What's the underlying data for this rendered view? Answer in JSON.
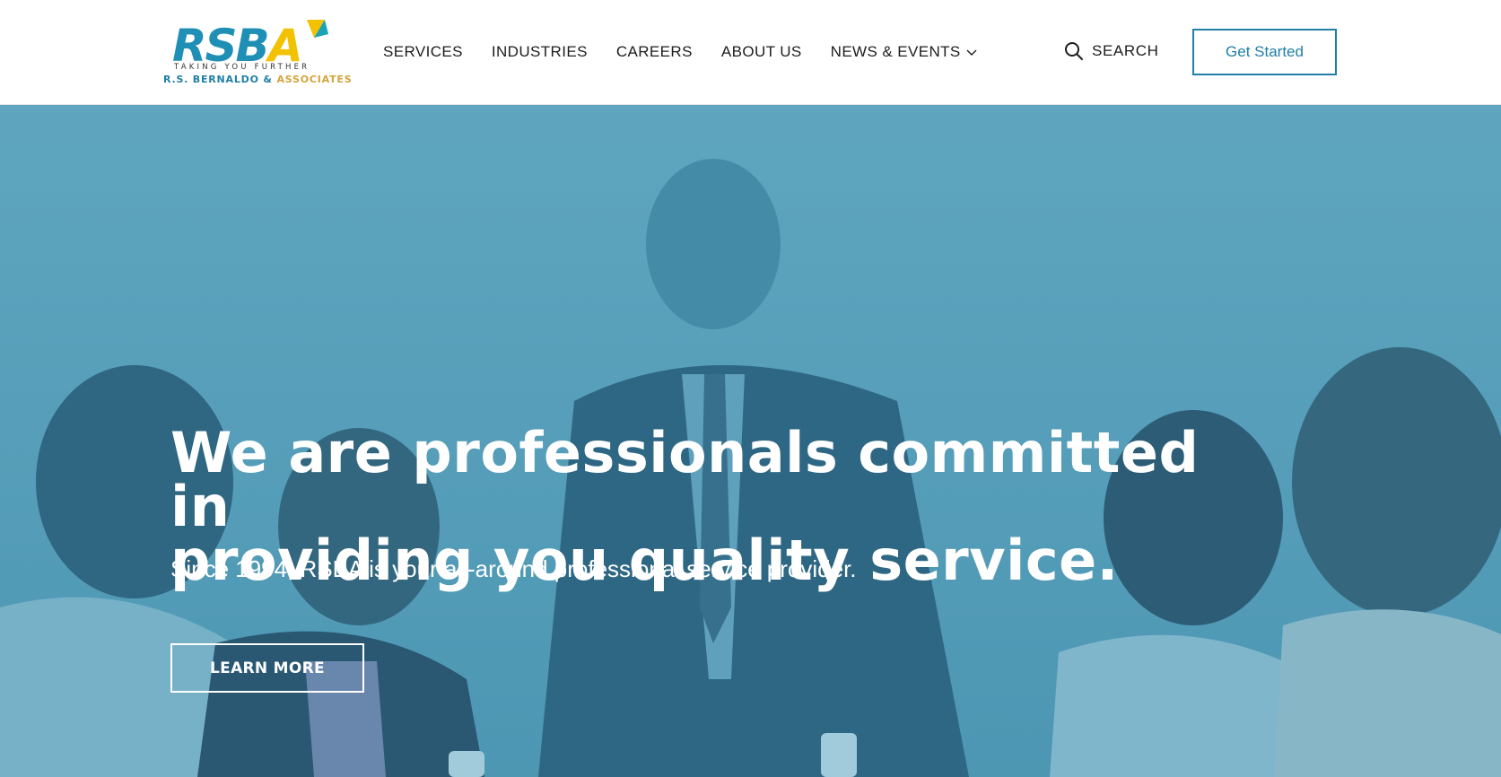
{
  "brand": {
    "logo_text": "RSBA",
    "tagline": "TAKING YOU FURTHER",
    "company_part1": "R.S. BERNALDO &",
    "company_part2": "ASSOCIATES",
    "colors": {
      "blue": "#1f7fa6",
      "gold": "#d3a43c",
      "yellow": "#f2c200",
      "teal": "#1aa3b5"
    }
  },
  "nav": {
    "items": [
      {
        "label": "SERVICES"
      },
      {
        "label": "INDUSTRIES"
      },
      {
        "label": "CAREERS"
      },
      {
        "label": "ABOUT US"
      },
      {
        "label": "NEWS & EVENTS",
        "icon": "chevron-down-icon"
      }
    ]
  },
  "search": {
    "label": "SEARCH",
    "icon": "search-icon"
  },
  "header_cta": {
    "label": "Get Started"
  },
  "hero": {
    "title_line1": "We are professionals committed in",
    "title_line2": "providing you quality service.",
    "subtitle": "Since 1994, RSBA is your all-around professional service provider.",
    "button_label": "LEARN MORE",
    "overlay_color": "#5ea6bf"
  }
}
